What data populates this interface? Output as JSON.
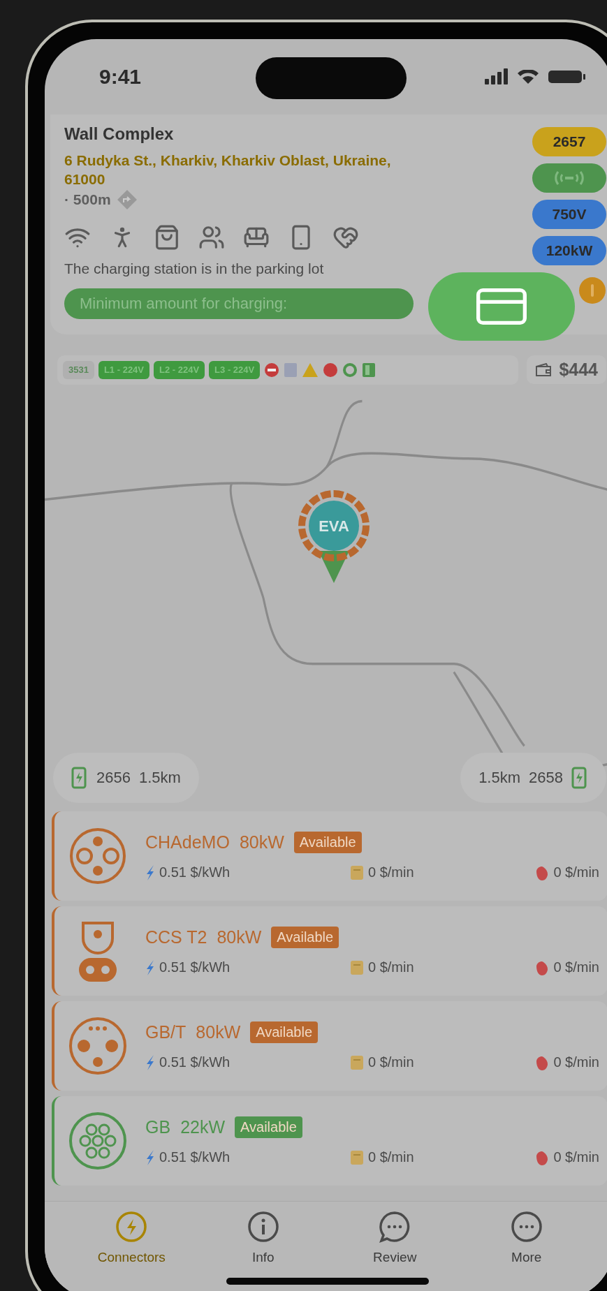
{
  "status_bar": {
    "time": "9:41"
  },
  "station": {
    "name": "Wall Complex",
    "address": "6 Rudyka St., Kharkiv, Kharkiv Oblast, Ukraine, 61000",
    "separator": "·",
    "distance": "500m",
    "note": "The charging station is in the parking lot",
    "minimum_amount_label": "Minimum amount for charging:"
  },
  "badges": [
    {
      "kind": "text",
      "label": "2657",
      "color": "#c9a21c"
    },
    {
      "kind": "wireless",
      "color": "#4e944e"
    },
    {
      "kind": "text",
      "label": "750V",
      "color": "#3a78cc"
    },
    {
      "kind": "text",
      "label": "120kW",
      "color": "#3a78cc"
    }
  ],
  "status_row": {
    "pills": [
      {
        "kind": "count",
        "label": "3531"
      },
      {
        "kind": "phase",
        "label": "L1 - 224V"
      },
      {
        "kind": "phase",
        "label": "L2 - 224V"
      },
      {
        "kind": "phase",
        "label": "L3 - 224V"
      }
    ],
    "indicators": [
      {
        "kind": "no-entry",
        "color": "#c43c3c"
      },
      {
        "kind": "square",
        "color": "#9aa0b4"
      },
      {
        "kind": "warning",
        "color": "#c9a21c"
      },
      {
        "kind": "dot",
        "color": "#c43c3c"
      },
      {
        "kind": "ring",
        "color": "#4e944e"
      },
      {
        "kind": "door",
        "color": "#4e944e"
      }
    ],
    "balance": "$444"
  },
  "map": {
    "marker": {
      "label": "EVA"
    },
    "nearby": [
      {
        "number": "2656",
        "distance": "1.5km"
      },
      {
        "number": "2658",
        "distance": "1.5km"
      }
    ]
  },
  "connectors": [
    {
      "kind": "chademo",
      "name": "CHAdeMO",
      "power": "80kW",
      "status": "Available",
      "color": "#b8682f",
      "energy_price": "0.51 $/kWh",
      "time_price": "0 $/min",
      "idle_price": "0 $/min"
    },
    {
      "kind": "ccs",
      "name": "CCS T2",
      "power": "80kW",
      "status": "Available",
      "color": "#b8682f",
      "energy_price": "0.51 $/kWh",
      "time_price": "0 $/min",
      "idle_price": "0 $/min"
    },
    {
      "kind": "gbt",
      "name": "GB/T",
      "power": "80kW",
      "status": "Available",
      "color": "#b8682f",
      "energy_price": "0.51 $/kWh",
      "time_price": "0 $/min",
      "idle_price": "0 $/min"
    },
    {
      "kind": "gb",
      "name": "GB",
      "power": "22kW",
      "status": "Available",
      "color": "#4e944e",
      "energy_price": "0.51 $/kWh",
      "time_price": "0 $/min",
      "idle_price": "0 $/min"
    }
  ],
  "tabs": [
    {
      "kind": "connectors",
      "label": "Connectors",
      "selected": true
    },
    {
      "kind": "info",
      "label": "Info",
      "selected": false
    },
    {
      "kind": "review",
      "label": "Review",
      "selected": false
    },
    {
      "kind": "more",
      "label": "More",
      "selected": false
    }
  ]
}
